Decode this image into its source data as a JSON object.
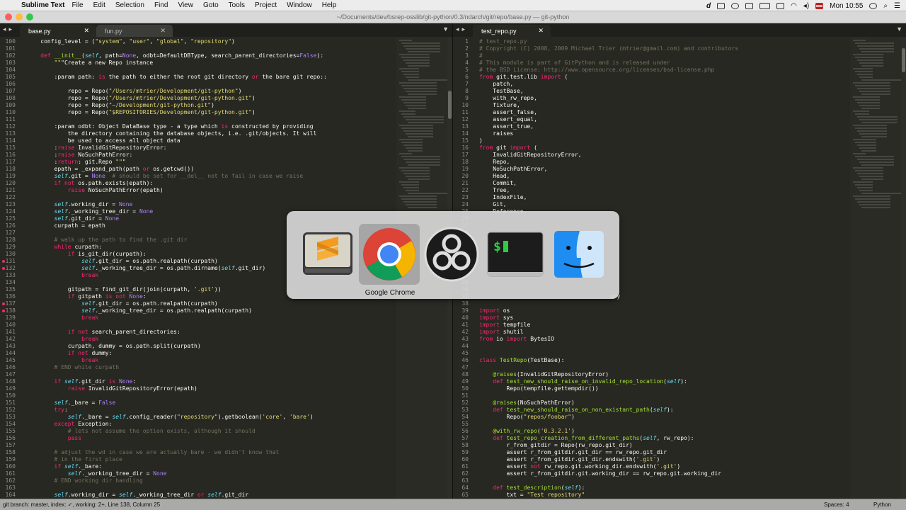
{
  "menubar": {
    "app_name": "Sublime Text",
    "items": [
      "File",
      "Edit",
      "Selection",
      "Find",
      "View",
      "Goto",
      "Tools",
      "Project",
      "Window",
      "Help"
    ],
    "clock": "Mon 10:55"
  },
  "titlebar": {
    "title": "~/Documents/dev/bsrep-osslib/git-python/0.3/ndarch/git/repo/base.py — git-python"
  },
  "left_tabs": [
    {
      "label": "base.py",
      "active": true
    },
    {
      "label": "fun.py",
      "active": false
    }
  ],
  "right_tabs": [
    {
      "label": "test_repo.py",
      "active": true
    }
  ],
  "left_code": {
    "first_line": 100,
    "breakpoints": [
      131,
      132,
      137,
      138
    ],
    "lines": [
      "    config_level = (\"system\", \"user\", \"global\", \"repository\")",
      "",
      "    def __init__(self, path=None, odbt=DefaultDBType, search_parent_directories=False):",
      "        \"\"\"Create a new Repo instance",
      "",
      "        :param path: is the path to either the root git directory or the bare git repo::",
      "",
      "            repo = Repo(\"/Users/mtrier/Development/git-python\")",
      "            repo = Repo(\"/Users/mtrier/Development/git-python.git\")",
      "            repo = Repo(\"~/Development/git-python.git\")",
      "            repo = Repo(\"$REPOSITORIES/Development/git-python.git\")",
      "",
      "        :param odbt: Object DataBase type - a type which is constructed by providing",
      "            the directory containing the database objects, i.e. .git/objects. It will",
      "            be used to access all object data",
      "        :raise InvalidGitRepositoryError:",
      "        :raise NoSuchPathError:",
      "        :return: git.Repo \"\"\"",
      "        epath = _expand_path(path or os.getcwd())",
      "        self.git = None  # should be set for __del__ not to fail in case we raise",
      "        if not os.path.exists(epath):",
      "            raise NoSuchPathError(epath)",
      "",
      "        self.working_dir = None",
      "        self._working_tree_dir = None",
      "        self.git_dir = None",
      "        curpath = epath",
      "",
      "        # walk up the path to find the .git dir",
      "        while curpath:",
      "            if is_git_dir(curpath):",
      "                self.git_dir = os.path.realpath(curpath)",
      "                self._working_tree_dir = os.path.dirname(self.git_dir)",
      "                break",
      "",
      "            gitpath = find_git_dir(join(curpath, '.git'))",
      "            if gitpath is not None:",
      "                self.git_dir = os.path.realpath(curpath)",
      "                self._working_tree_dir = os.path.realpath(curpath)",
      "                break",
      "",
      "            if not search_parent_directories:",
      "                break",
      "            curpath, dummy = os.path.split(curpath)",
      "            if not dummy:",
      "                break",
      "        # END while curpath",
      "",
      "        if self.git_dir is None:",
      "            raise InvalidGitRepositoryError(epath)",
      "",
      "        self._bare = False",
      "        try:",
      "            self._bare = self.config_reader(\"repository\").getboolean('core', 'bare')",
      "        except Exception:",
      "            # lets not assume the option exists, although it should",
      "            pass",
      "",
      "        # adjust the wd in case we are actually bare - we didn't know that",
      "        # in the first place",
      "        if self._bare:",
      "            self._working_tree_dir = None",
      "        # END working dir handling",
      "",
      "        self.working_dir = self._working_tree_dir or self.git_dir"
    ]
  },
  "right_code": {
    "first_line": 1,
    "lines": [
      "# test_repo.py",
      "# Copyright (C) 2008, 2009 Michael Trier (mtrier@gmail.com) and contributors",
      "#",
      "# This module is part of GitPython and is released under",
      "# the BSD License: http://www.opensource.org/licenses/bsd-license.php",
      "from git.test.lib import (",
      "    patch,",
      "    TestBase,",
      "    with_rw_repo,",
      "    fixture,",
      "    assert_false,",
      "    assert_equal,",
      "    assert_true,",
      "    raises",
      ")",
      "from git import (",
      "    InvalidGitRepositoryError,",
      "    Repo,",
      "    NoSuchPathError,",
      "    Head,",
      "    Commit,",
      "    Tree,",
      "    IndexFile,",
      "    Git,",
      "    Reference,",
      "",
      "",
      "",
      "",
      "",
      "",
      "",
      "",
      "",
      "",
      "",
      "",
      "",
      "import os",
      "import sys",
      "import tempfile",
      "import shutil",
      "from io import BytesIO",
      "",
      "",
      "class TestRepo(TestBase):",
      "",
      "    @raises(InvalidGitRepositoryError)",
      "    def test_new_should_raise_on_invalid_repo_location(self):",
      "        Repo(tempfile.gettempdir())",
      "",
      "    @raises(NoSuchPathError)",
      "    def test_new_should_raise_on_non_existant_path(self):",
      "        Repo(\"repos/foobar\")",
      "",
      "    @with_rw_repo('0.3.2.1')",
      "    def test_repo_creation_from_different_paths(self, rw_repo):",
      "        r_from_gitdir = Repo(rw_repo.git_dir)",
      "        assert r_from_gitdir.git_dir == rw_repo.git_dir",
      "        assert r_from_gitdir.git_dir.endswith('.git')",
      "        assert not rw_repo.git.working_dir.endswith('.git')",
      "        assert r_from_gitdir.git.working_dir == rw_repo.git.working_dir",
      "",
      "    def test_description(self):",
      "        txt = \"Test repository\""
    ],
    "partial_line_38": "ory"
  },
  "switcher": {
    "apps": [
      {
        "name": "Sublime Text",
        "icon": "sublime-text-icon"
      },
      {
        "name": "Google Chrome",
        "icon": "chrome-icon"
      },
      {
        "name": "OBS",
        "icon": "obs-icon"
      },
      {
        "name": "Terminal",
        "icon": "terminal-icon"
      },
      {
        "name": "Finder",
        "icon": "finder-icon"
      }
    ],
    "selected_label": "Google Chrome"
  },
  "statusbar": {
    "left": "git branch: master, index: ✓, working: 2+, Line 138, Column 25",
    "spaces": "Spaces: 4",
    "syntax": "Python"
  },
  "colors": {
    "background": "#272822",
    "keyword": "#f92672",
    "function": "#a6e22e",
    "string": "#e6db74",
    "comment": "#75715e",
    "builtin": "#66d9ef"
  }
}
